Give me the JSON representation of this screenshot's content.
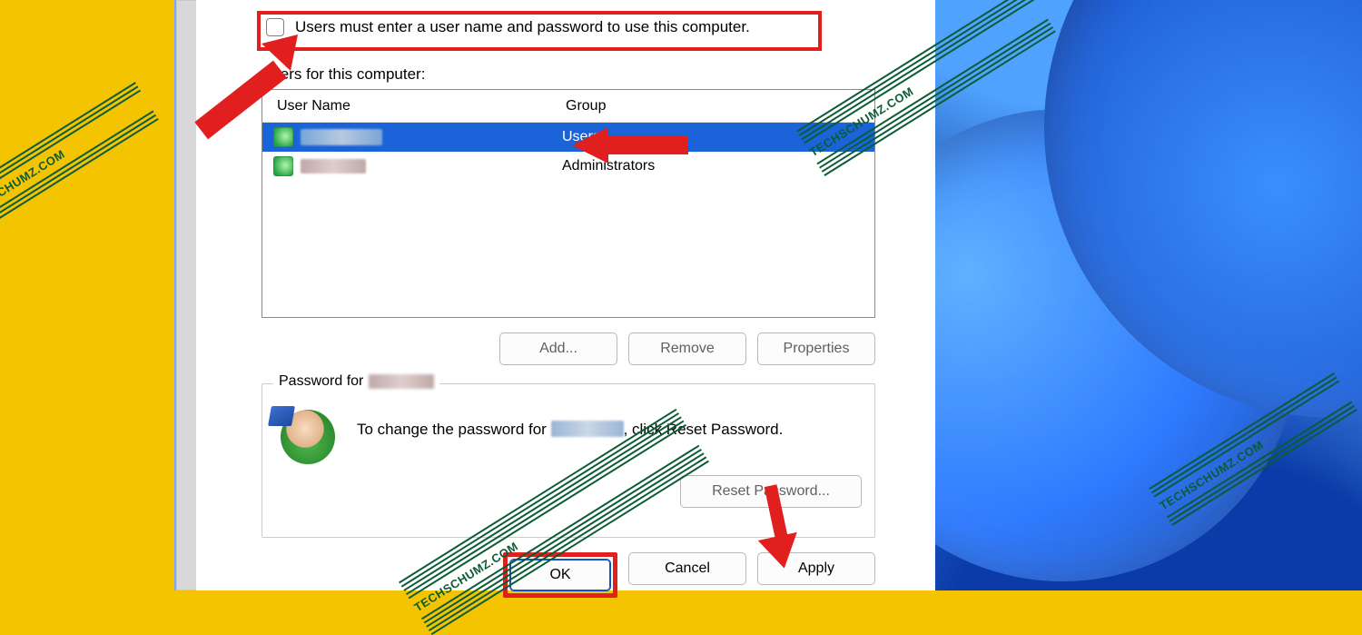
{
  "checkbox": {
    "label": "Users must enter a user name and password to use this computer.",
    "checked": false
  },
  "users_section": {
    "label": "Users for this computer:",
    "columns": {
      "user": "User Name",
      "group": "Group"
    },
    "rows": [
      {
        "group": "Users",
        "selected": true
      },
      {
        "group": "Administrators",
        "selected": false
      }
    ]
  },
  "list_buttons": {
    "add": "Add...",
    "remove": "Remove",
    "properties": "Properties"
  },
  "password_group": {
    "legend_prefix": "Password for ",
    "text_before": "To change the password for ",
    "text_after": ", click Reset Password.",
    "reset_button": "Reset Password..."
  },
  "dialog_buttons": {
    "ok": "OK",
    "cancel": "Cancel",
    "apply": "Apply"
  },
  "watermark_text": "TECHSCHUMZ.COM",
  "colors": {
    "highlight_red": "#e11f1f",
    "selection_blue": "#1a63d9",
    "brand_yellow": "#f5c400",
    "watermark_green": "#0b5c36"
  }
}
